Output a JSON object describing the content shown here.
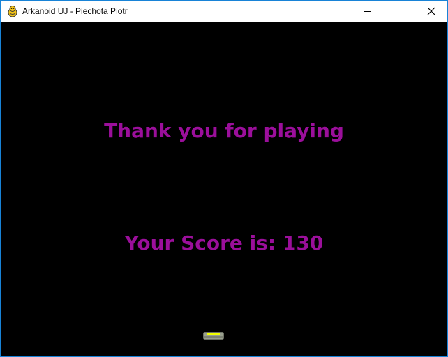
{
  "window": {
    "title": "Arkanoid UJ - Piechota Piotr",
    "app_icon": "pygame-snake-icon",
    "controls": {
      "minimize_icon": "minimize-icon",
      "maximize_icon": "maximize-icon",
      "close_icon": "close-icon"
    }
  },
  "game": {
    "message": "Thank you for playing",
    "score_label": "Your Score is:",
    "score_value": "130",
    "score_text": "Your Score is: 130",
    "text_color": "#9b0f9b",
    "background_color": "#000000",
    "paddle_color": "#9aa08f",
    "paddle_accent_color": "#f2ff00"
  }
}
